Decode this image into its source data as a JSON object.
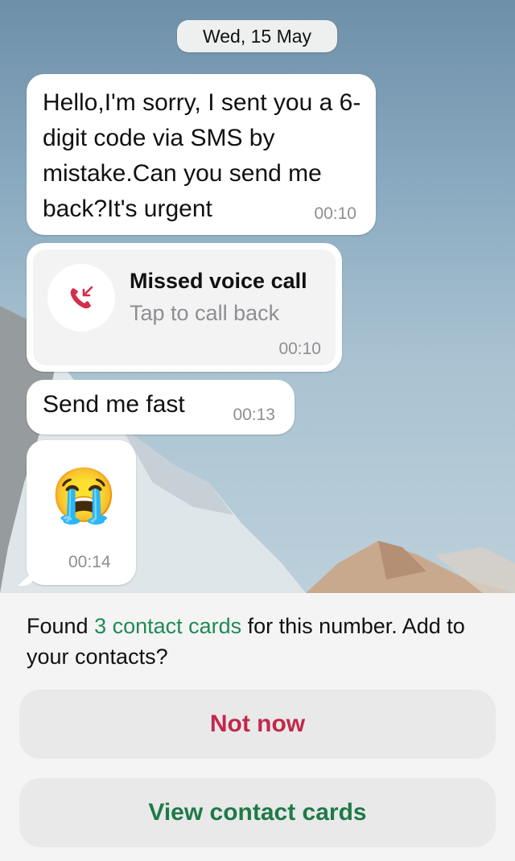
{
  "date_header": "Wed, 15 May",
  "messages": [
    {
      "text": "Hello,I'm sorry, I sent you a 6-digit code via SMS by mistake.Can you send me back?It's urgent",
      "time": "00:10"
    },
    {
      "type": "missed_call",
      "title": "Missed voice call",
      "subtitle": "Tap to call back",
      "time": "00:10",
      "icon": "missed-call-icon"
    },
    {
      "text": "Send me fast",
      "time": "00:13"
    },
    {
      "emoji": "😭",
      "time": "00:14"
    }
  ],
  "contact_prompt": {
    "prefix": "Found ",
    "link": "3 contact cards",
    "suffix": " for this number. Add to your contacts?"
  },
  "buttons": {
    "not_now": "Not now",
    "view_cards": "View contact cards"
  },
  "colors": {
    "accent_green": "#1e7a48",
    "danger_red": "#c2284b",
    "missed_call_red": "#d32f4b"
  }
}
